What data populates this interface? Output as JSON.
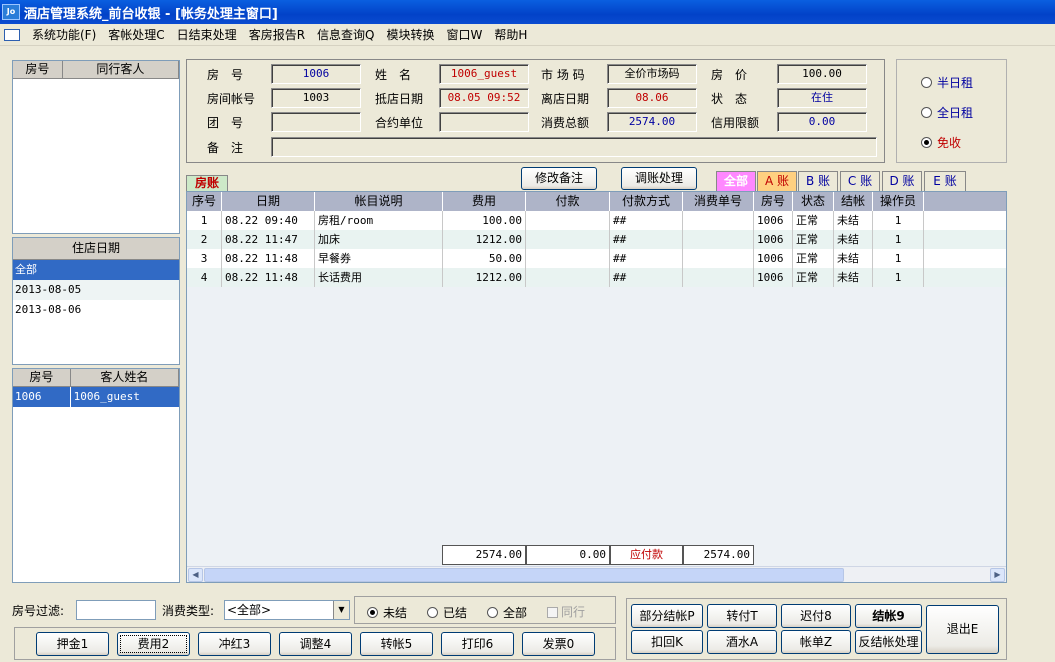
{
  "window": {
    "title": "酒店管理系统_前台收银 - [帐务处理主窗口]",
    "icon_text": "Jo"
  },
  "menu": [
    "系统功能(F)",
    "客帐处理C",
    "日结束处理",
    "客房报告R",
    "信息查询Q",
    "模块转换",
    "窗口W",
    "帮助H"
  ],
  "companions": {
    "col_room": "房号",
    "col_guest": "同行客人"
  },
  "stay_dates": {
    "header": "住店日期",
    "items": [
      "全部",
      "2013-08-05",
      "2013-08-06"
    ]
  },
  "guests": {
    "col_room": "房号",
    "col_name": "客人姓名",
    "rows": [
      {
        "room": "1006",
        "name": "1006_guest"
      }
    ]
  },
  "info": {
    "room_no_label": "房　号",
    "room_no": "1006",
    "name_label": "姓　名",
    "name": "1006_guest",
    "market_label": "市 场 码",
    "market": "全价市场码",
    "price_label": "房　价",
    "price": "100.00",
    "account_label": "房间帐号",
    "account": "1003",
    "arrive_label": "抵店日期",
    "arrive": "08.05 09:52",
    "depart_label": "离店日期",
    "depart": "08.06",
    "status_label": "状　态",
    "status": "在住",
    "group_label": "团　号",
    "group": "",
    "contract_label": "合约单位",
    "contract": "",
    "total_label": "消费总额",
    "total": "2574.00",
    "credit_label": "信用限额",
    "credit": "0.00",
    "remark_label": "备　注",
    "remark": ""
  },
  "rent_options": [
    {
      "label": "半日租",
      "selected": false
    },
    {
      "label": "全日租",
      "selected": false
    },
    {
      "label": "免收",
      "selected": true
    }
  ],
  "actions": {
    "edit_remark": "修改备注",
    "adjust": "调账处理"
  },
  "tabs": {
    "room_account": "房账",
    "all": "全部",
    "a": "A 账",
    "b": "B 账",
    "c": "C 账",
    "d": "D 账",
    "e": "E 账"
  },
  "table": {
    "headers": [
      "序号",
      "日期",
      "帐目说明",
      "费用",
      "付款",
      "付款方式",
      "消费单号",
      "房号",
      "状态",
      "结帐",
      "操作员"
    ],
    "rows": [
      [
        "1",
        "08.22 09:40",
        "房租/room",
        "100.00",
        "",
        "##",
        "",
        "1006",
        "正常",
        "未结",
        "1"
      ],
      [
        "2",
        "08.22 11:47",
        "加床",
        "1212.00",
        "",
        "##",
        "",
        "1006",
        "正常",
        "未结",
        "1"
      ],
      [
        "3",
        "08.22 11:48",
        "早餐券",
        "50.00",
        "",
        "##",
        "",
        "1006",
        "正常",
        "未结",
        "1"
      ],
      [
        "4",
        "08.22 11:48",
        "长话费用",
        "1212.00",
        "",
        "##",
        "",
        "1006",
        "正常",
        "未结",
        "1"
      ]
    ],
    "totals": {
      "fee": "2574.00",
      "paid": "0.00",
      "due_label": "应付款",
      "due": "2574.00"
    }
  },
  "filters": {
    "room_label": "房号过滤:",
    "room_value": "",
    "type_label": "消费类型:",
    "type_value": "<全部>",
    "status_options": [
      {
        "label": "未结",
        "selected": true
      },
      {
        "label": "已结",
        "selected": false
      },
      {
        "label": "全部",
        "selected": false
      }
    ],
    "together_label": "同行"
  },
  "bottom_buttons": [
    "押金1",
    "费用2",
    "冲红3",
    "调整4",
    "转帐5",
    "打印6",
    "发票0"
  ],
  "right_buttons": {
    "partial": "部分结帐P",
    "transfer_pay": "转付T",
    "late": "迟付8",
    "checkout": "结帐9",
    "deduct": "扣回K",
    "bar": "酒水A",
    "bill": "帐单Z",
    "undo": "反结帐处理",
    "exit": "退出E"
  },
  "colors": {
    "title_blue": "#0242c8",
    "selection": "#316ac5",
    "red_text": "#c00000",
    "blue_text": "#0000a0",
    "all_tab": "#ff88ff",
    "a_tab": "#ffd080"
  }
}
